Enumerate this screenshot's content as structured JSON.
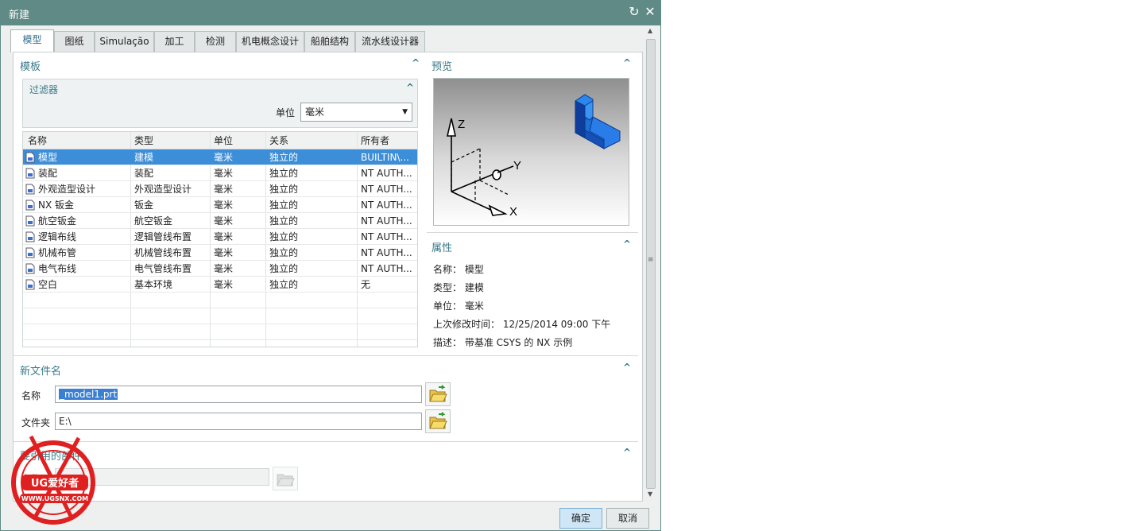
{
  "window": {
    "title": "新建"
  },
  "colors": {
    "titlebar": "#5f8a85",
    "accent": "#3a7a8a",
    "selection": "#3d8ed8"
  },
  "tabs": [
    "模型",
    "图纸",
    "Simulação",
    "加工",
    "检测",
    "机电概念设计",
    "船舶结构",
    "流水线设计器"
  ],
  "template": {
    "title": "模板",
    "filter": {
      "title": "过滤器",
      "unit_label": "单位",
      "unit_value": "毫米"
    },
    "columns": [
      "名称",
      "类型",
      "单位",
      "关系",
      "所有者"
    ],
    "rows": [
      {
        "name": "模型",
        "type": "建模",
        "unit": "毫米",
        "relation": "独立的",
        "owner": "BUILTIN\\...",
        "icon": "model-icon"
      },
      {
        "name": "装配",
        "type": "装配",
        "unit": "毫米",
        "relation": "独立的",
        "owner": "NT AUTH...",
        "icon": "assembly-icon"
      },
      {
        "name": "外观造型设计",
        "type": "外观造型设计",
        "unit": "毫米",
        "relation": "独立的",
        "owner": "NT AUTH...",
        "icon": "shape-studio-icon"
      },
      {
        "name": "NX 钣金",
        "type": "钣金",
        "unit": "毫米",
        "relation": "独立的",
        "owner": "NT AUTH...",
        "icon": "sheet-metal-icon"
      },
      {
        "name": "航空钣金",
        "type": "航空钣金",
        "unit": "毫米",
        "relation": "独立的",
        "owner": "NT AUTH...",
        "icon": "aero-sheet-metal-icon"
      },
      {
        "name": "逻辑布线",
        "type": "逻辑管线布置",
        "unit": "毫米",
        "relation": "独立的",
        "owner": "NT AUTH...",
        "icon": "logical-routing-icon"
      },
      {
        "name": "机械布管",
        "type": "机械管线布置",
        "unit": "毫米",
        "relation": "独立的",
        "owner": "NT AUTH...",
        "icon": "mechanical-routing-icon"
      },
      {
        "name": "电气布线",
        "type": "电气管线布置",
        "unit": "毫米",
        "relation": "独立的",
        "owner": "NT AUTH...",
        "icon": "electrical-routing-icon"
      },
      {
        "name": "空白",
        "type": "基本环境",
        "unit": "毫米",
        "relation": "独立的",
        "owner": "无",
        "icon": "blank-file-icon"
      }
    ]
  },
  "preview": {
    "title": "预览",
    "axis_z": "Z",
    "axis_y": "Y",
    "axis_x": "X"
  },
  "properties": {
    "title": "属性",
    "lines": [
      "名称： 模型",
      "类型： 建模",
      "单位： 毫米",
      "上次修改时间： 12/25/2014 09:00 下午",
      "描述： 带基准 CSYS 的 NX 示例"
    ]
  },
  "new_file": {
    "title": "新文件名",
    "name_label": "名称",
    "name_value": "_model1.prt",
    "folder_label": "文件夹",
    "folder_value": "E:\\"
  },
  "referenced": {
    "title": "要引用的部件",
    "name_label": "名称"
  },
  "buttons": {
    "ok": "确定",
    "cancel": "取消"
  },
  "watermark": {
    "brand": "UG爱好者",
    "url": "WWW.UGSNX.COM"
  }
}
